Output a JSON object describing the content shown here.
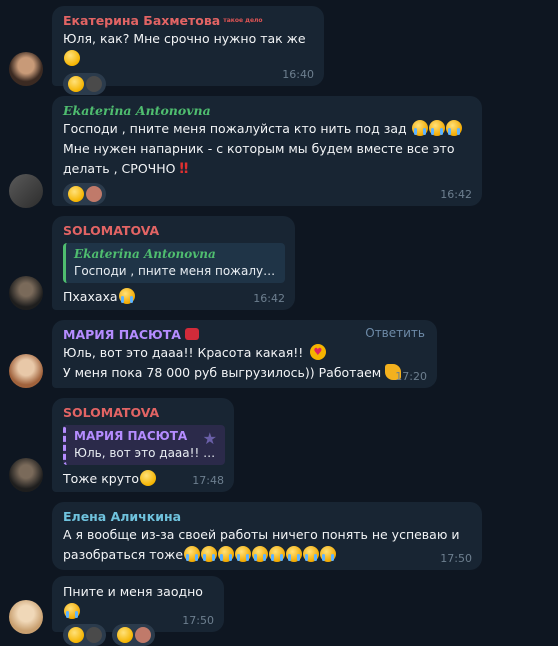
{
  "messages": [
    {
      "author": "Екатерина Бахметова",
      "author_color": "#e26464",
      "badge": "такое дело",
      "text": "Юля, как? Мне срочно нужно так же",
      "time": "16:40"
    },
    {
      "author": "Ekaterina Antonovna",
      "author_color": "#4fbd6f",
      "line1": "Господи , пните меня пожалуйста кто нить под зад",
      "line2": "Мне нужен напарник - с которым мы будем вместе все это",
      "line3": "делать , СРОЧНО",
      "time": "16:42"
    },
    {
      "author": "SOLOMATOVA",
      "author_color": "#e26464",
      "quote_author": "Ekaterina Antonovna",
      "quote_text": "Господи , пните меня пожалуй...",
      "text": "Пхахаха",
      "time": "16:42"
    },
    {
      "author": "МАРИЯ ПАСЮТА",
      "author_color": "#b58cff",
      "reply_label": "Ответить",
      "line1": "Юль, вот это дааа!! Красота какая!!",
      "line2": "У меня пока 78 000 руб выгрузилось)) Работаем",
      "time": "17:20"
    },
    {
      "author": "SOLOMATOVA",
      "author_color": "#e26464",
      "quote_author": "МАРИЯ ПАСЮТА",
      "quote_text": "Юль, вот это дааа!! Кр...",
      "text": "Тоже круто",
      "time": "17:48"
    },
    {
      "author": "Елена Аличкина",
      "author_color": "#6fc2dd",
      "line1": "А я вообще из-за своей работы ничего понять не успеваю и",
      "line2": "разобраться тоже",
      "time": "17:50"
    },
    {
      "text": "Пните и меня заодно",
      "time": "17:50"
    }
  ]
}
